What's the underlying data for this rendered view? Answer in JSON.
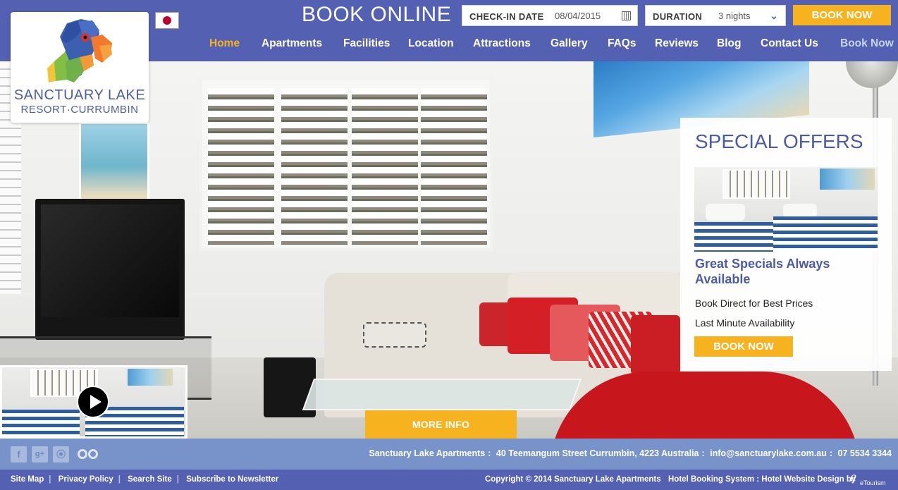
{
  "header": {
    "book_online": "BOOK ONLINE",
    "checkin_label": "CHECK-IN DATE",
    "checkin_value": "08/04/2015",
    "duration_label": "DURATION",
    "duration_value": "3 nights",
    "book_now": "BOOK NOW",
    "language_flag": "japan-flag-icon"
  },
  "nav": {
    "items": [
      {
        "label": "Home",
        "active": true
      },
      {
        "label": "Apartments"
      },
      {
        "label": "Facilities"
      },
      {
        "label": "Location"
      },
      {
        "label": "Attractions"
      },
      {
        "label": "Gallery"
      },
      {
        "label": "FAQs"
      },
      {
        "label": "Reviews"
      },
      {
        "label": "Blog"
      },
      {
        "label": "Contact Us"
      },
      {
        "label": "Book Now"
      }
    ]
  },
  "logo": {
    "line1": "SANCTUARY LAKE",
    "line2": "RESORT·CURRUMBIN",
    "icon": "lorikeet-logo-icon"
  },
  "offers": {
    "title": "SPECIAL OFFERS",
    "subtitle": "Great Specials Always Available",
    "line1": "Book Direct for Best Prices",
    "line2": "Last Minute Availability",
    "button": "BOOK NOW"
  },
  "hero": {
    "more_info": "MORE INFO",
    "video_icon": "play-icon"
  },
  "footer": {
    "social": [
      "facebook-icon",
      "google-plus-icon",
      "rss-icon",
      "tripadvisor-icon"
    ],
    "social_glyphs": [
      "f",
      "g+",
      "⦿"
    ],
    "address_name": "Sanctuary Lake Apartments",
    "address_street": "40 Teemangum Street Currumbin, 4223 Australia",
    "email": "info@sanctuarylake.com.au",
    "phone": "07 5534 3344",
    "links": [
      "Site Map",
      "Privacy Policy",
      "Search Site",
      "Subscribe to Newsletter"
    ],
    "copyright": "Copyright © 2014 Sanctuary Lake Apartments",
    "credit": "Hotel Booking System : Hotel Website Design by",
    "credit_logo": "eTourism"
  },
  "colors": {
    "header_blue": "#5461b3",
    "footer_light_blue": "#7893c9",
    "accent_orange": "#f7b220",
    "nav_active": "#f7b220",
    "nav_book_now": "#c7d3f3",
    "offers_title": "#4d5aa5"
  }
}
